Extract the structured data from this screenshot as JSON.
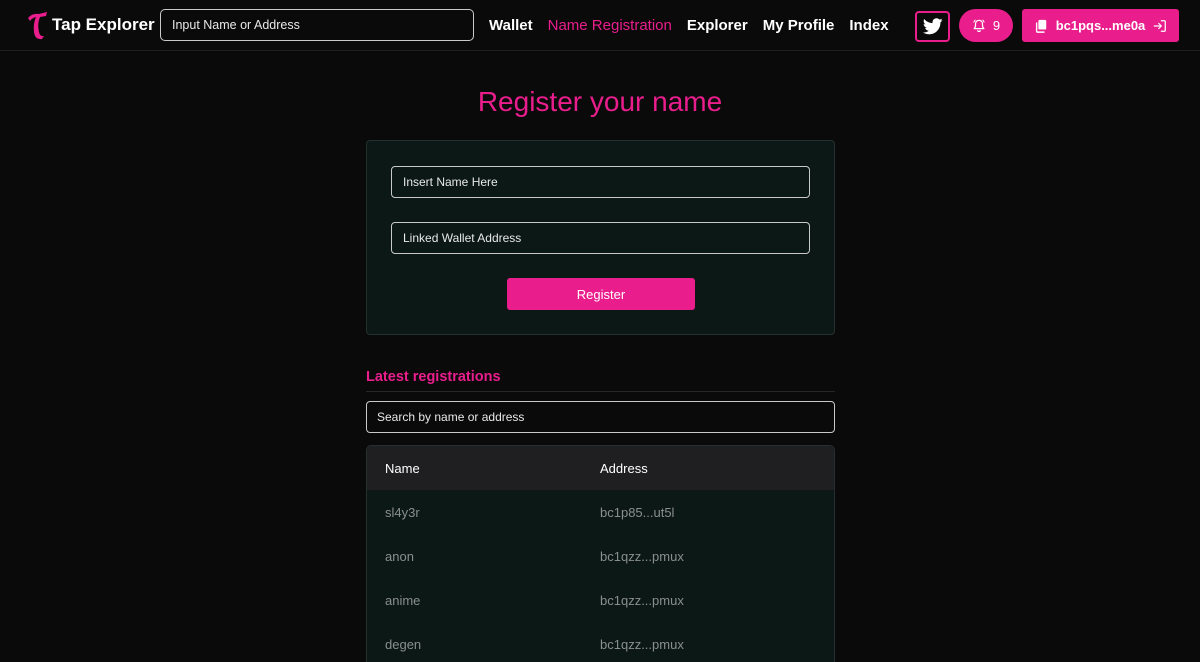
{
  "brand": {
    "name": "Tap Explorer"
  },
  "header": {
    "search_placeholder": "Input Name or Address",
    "nav": [
      "Wallet",
      "Name Registration",
      "Explorer",
      "My Profile",
      "Index"
    ],
    "active_nav": "Name Registration",
    "twitter_icon": "twitter-icon",
    "notifications": {
      "icon": "bell-icon",
      "count": "9"
    },
    "wallet": {
      "address": "bc1pqs...me0a",
      "copy_icon": "copy-icon",
      "logout_icon": "logout-icon"
    }
  },
  "register": {
    "title": "Register your name",
    "name_placeholder": "Insert Name Here",
    "wallet_placeholder": "Linked Wallet Address",
    "button_label": "Register"
  },
  "latest": {
    "title": "Latest registrations",
    "search_placeholder": "Search by name or address",
    "columns": [
      "Name",
      "Address"
    ],
    "rows": [
      {
        "name": "sl4y3r",
        "address": "bc1p85...ut5l"
      },
      {
        "name": "anon",
        "address": "bc1qzz...pmux"
      },
      {
        "name": "anime",
        "address": "bc1qzz...pmux"
      },
      {
        "name": "degen",
        "address": "bc1qzz...pmux"
      }
    ]
  },
  "colors": {
    "accent": "#e91e8c",
    "background": "#0a0a0b",
    "card": "#0b1816"
  }
}
